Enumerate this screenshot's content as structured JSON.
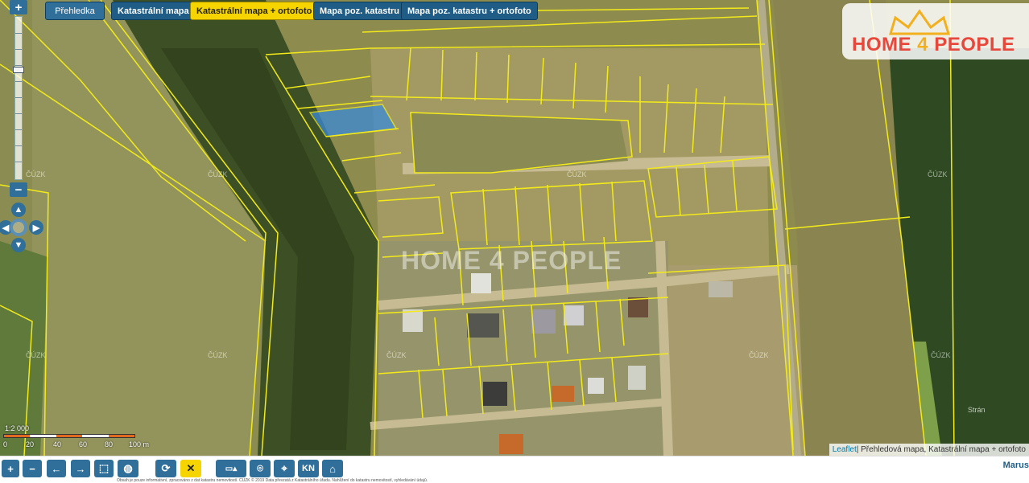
{
  "layers": [
    {
      "label": "Přehledka",
      "state": "plain"
    },
    {
      "label": "Katastrální mapa",
      "state": "normal"
    },
    {
      "label": "Katastrální mapa + ortofoto",
      "state": "active"
    },
    {
      "label": "Mapa poz. katastru",
      "state": "normal"
    },
    {
      "label": "Mapa poz. katastru + ortofoto",
      "state": "normal"
    }
  ],
  "zoom": {
    "plus": "+",
    "minus": "−"
  },
  "logo": {
    "part1": "HOME ",
    "part2": "4",
    "part3": " PEOPLE"
  },
  "watermark": "HOME 4 PEOPLE",
  "cuzk_label": "ČÚZK",
  "place_label": "Strán",
  "scale": {
    "ratio": "1:2 000",
    "ticks": [
      "0",
      "20",
      "40",
      "60",
      "80",
      "100 m"
    ]
  },
  "attribution": {
    "leaflet": "Leaflet",
    "rest": " | Přehledová mapa, Katastrální mapa + ortofoto"
  },
  "toolbar": {
    "buttons": [
      "+",
      "−",
      "←",
      "→",
      "⬚",
      "◍",
      "⟳",
      "✕",
      "▭▴",
      "⌾",
      "⌖",
      "KN",
      "⌂"
    ],
    "brand": "Marus",
    "footer": "Obsah je pouze informativní, zpracováno z dat katastru nemovitostí. ČÚZK © 2019 Data převzatá z Katastrálního úřadu. Nahlížení do katastru nemovitostí, vyhledávání údajů."
  },
  "colors": {
    "parcel_line": "#f2ea1a",
    "selected_parcel": "#3a8ad8",
    "field": "#8c8a4a",
    "forest": "#3e4e22"
  }
}
